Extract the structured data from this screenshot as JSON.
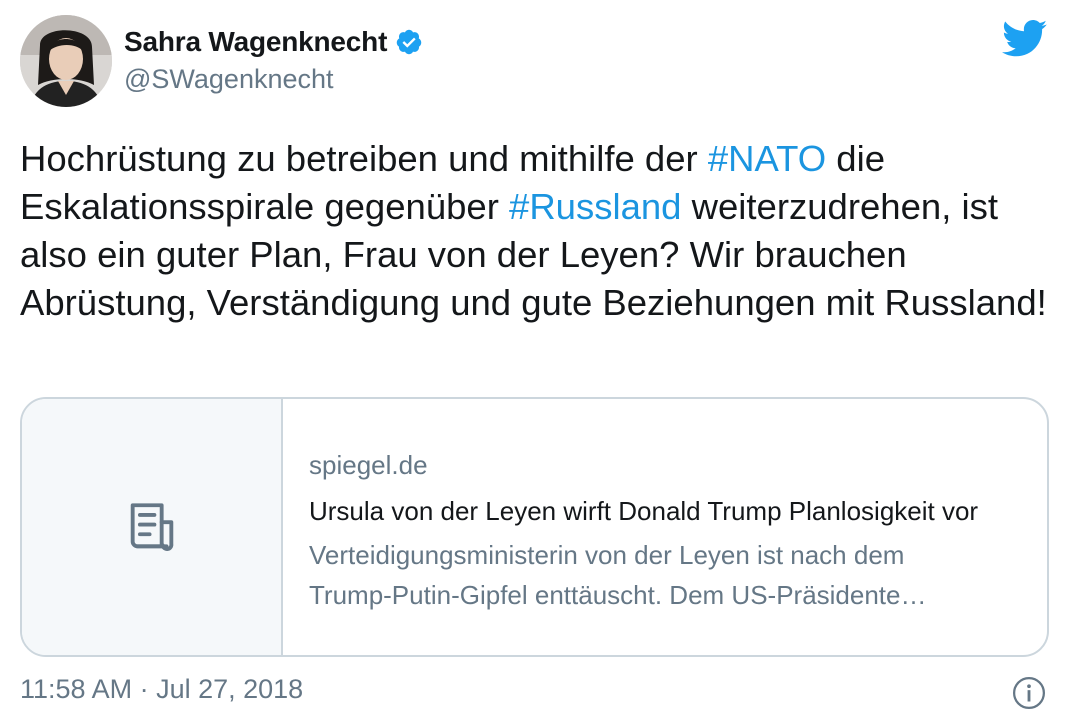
{
  "author": {
    "name": "Sahra Wagenknecht",
    "handle": "@SWagenknecht",
    "verified": true
  },
  "tweet": {
    "text_parts": [
      "Hochrüstung zu betreiben und mithilfe der ",
      "#NATO",
      " die Eskalationsspirale gegenüber ",
      "#Russland",
      " weiterzudrehen, ist also ein guter Plan, Frau von der Leyen? Wir brauchen Abrüstung, Verständigung und gute Beziehungen mit Russland!"
    ]
  },
  "card": {
    "domain": "spiegel.de",
    "title": "Ursula von der Leyen wirft Donald Trump Planlosigkeit vor",
    "desc_line1": "Verteidigungsministerin von der Leyen ist nach dem",
    "desc_line2": "Trump-Putin-Gipfel enttäuscht. Dem US-Präsidente…",
    "thumb_icon": "article-icon"
  },
  "meta": {
    "timestamp": "11:58 AM · Jul 27, 2018"
  },
  "icons": {
    "brand": "twitter-bird-icon",
    "verified": "verified-badge-icon",
    "info": "info-icon"
  },
  "colors": {
    "hashtag": "#1b95e0",
    "brand": "#1da1f2",
    "secondary_text": "#657786",
    "border": "#ccd6dd"
  }
}
